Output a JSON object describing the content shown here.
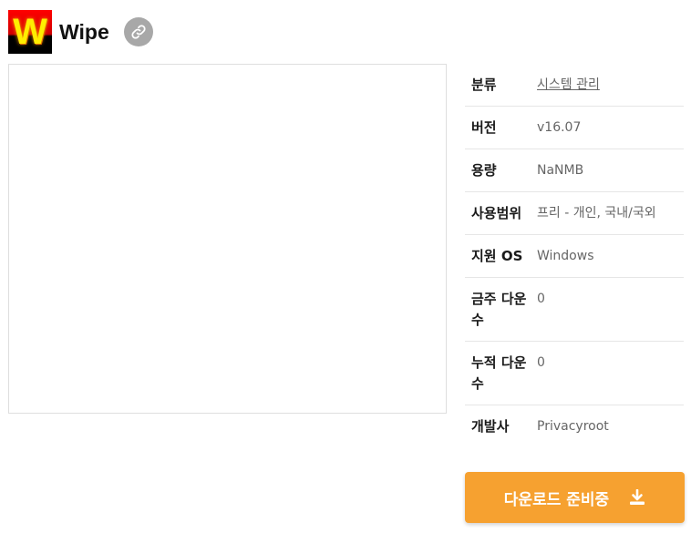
{
  "app": {
    "logo_letter": "W",
    "title": "Wipe",
    "link_icon": "link-icon"
  },
  "info": {
    "category": {
      "label": "분류",
      "value": "시스템 관리"
    },
    "version": {
      "label": "버전",
      "value": "v16.07"
    },
    "size": {
      "label": "용량",
      "value": "NaNMB"
    },
    "license": {
      "label": "사용범위",
      "value": "프리 - 개인, 국내/국외"
    },
    "os": {
      "label": "지원 OS",
      "value": "Windows"
    },
    "weekly_downloads": {
      "label": "금주 다운수",
      "value": "0"
    },
    "total_downloads": {
      "label": "누적 다운수",
      "value": "0"
    },
    "developer": {
      "label": "개발사",
      "value": "Privacyroot"
    }
  },
  "download": {
    "label": "다운로드 준비중",
    "icon": "download-icon"
  },
  "colors": {
    "download_button": "#f6a130",
    "link_button": "#a8a8a8"
  }
}
